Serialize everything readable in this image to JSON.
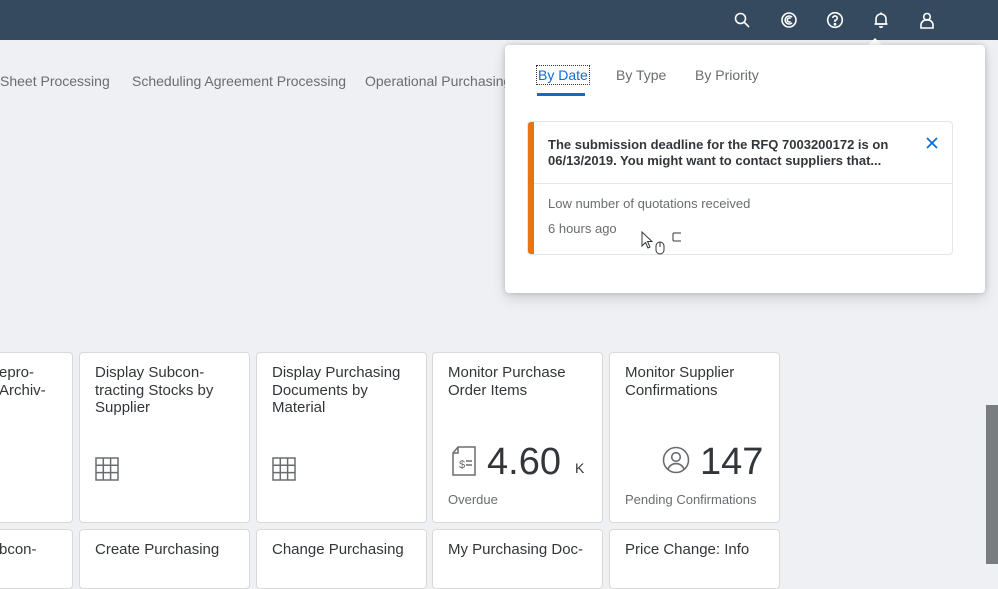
{
  "shellbar": {
    "icons": [
      "search-icon",
      "copilot-icon",
      "help-icon",
      "notifications-icon",
      "user-icon"
    ],
    "color": "#354a5f"
  },
  "tabs": [
    {
      "label": "Sheet Processing"
    },
    {
      "label": "Scheduling Agreement Processing"
    },
    {
      "label": "Operational Purchasing"
    }
  ],
  "tiles_row1": [
    {
      "title": "epro-\nArchiv-"
    },
    {
      "title": "Display Subcon-\ntracting Stocks by\nSupplier",
      "icon": "table-icon"
    },
    {
      "title": "Display Purchasing\nDocuments by\nMaterial",
      "icon": "table-icon"
    },
    {
      "title": "Monitor Purchase\nOrder Items",
      "kpi": "4.60",
      "unit": "K",
      "footer": "Overdue",
      "icon": "invoice-icon"
    },
    {
      "title": "Monitor Supplier\nConfirmations",
      "kpi": "147",
      "footer": "Pending Confirmations",
      "icon": "person-icon"
    }
  ],
  "tiles_row2": [
    {
      "title": "bcon-"
    },
    {
      "title": "Create Purchasing"
    },
    {
      "title": "Change Purchasing"
    },
    {
      "title": "My Purchasing Doc-"
    },
    {
      "title": "Price Change: Info"
    }
  ],
  "popover": {
    "tabs": [
      {
        "label": "By Date",
        "active": true
      },
      {
        "label": "By Type"
      },
      {
        "label": "By Priority"
      }
    ],
    "notification": {
      "title": "The submission deadline for the RFQ 7003200172 is on 06/13/2019. You might want to contact suppliers that...",
      "description": "Low number of quotations received",
      "time": "6 hours ago",
      "priority_color": "#e9730c"
    }
  },
  "accent_color": "#0a6ed1"
}
